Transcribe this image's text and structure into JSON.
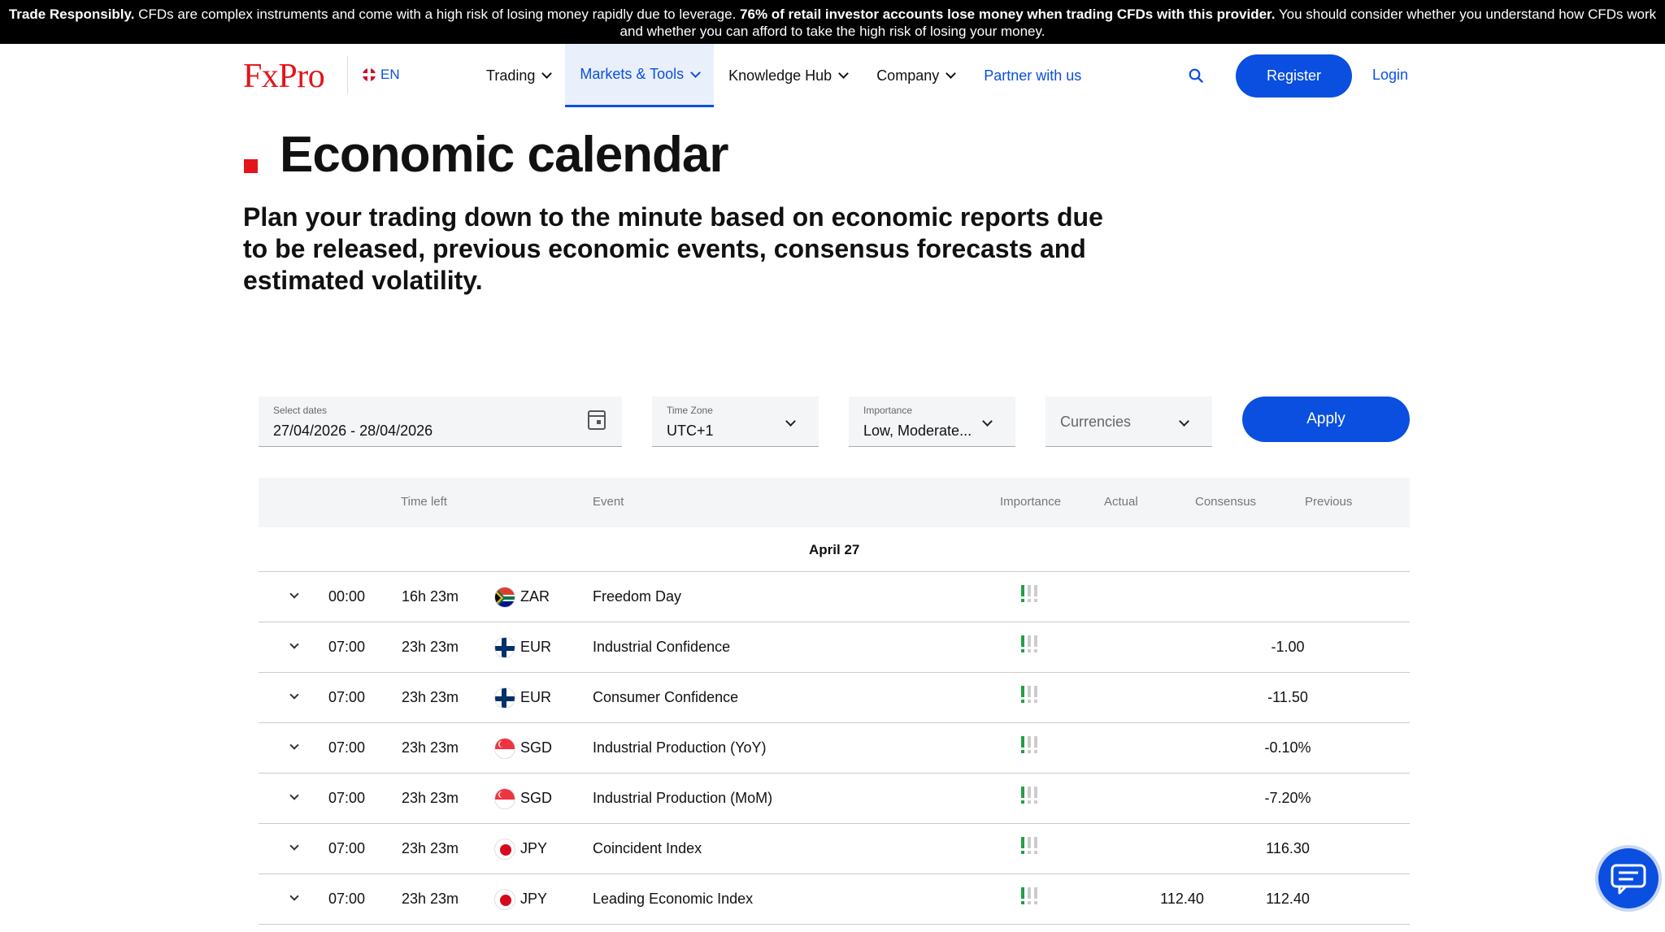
{
  "risk_warning": {
    "bold1": "Trade Responsibly.",
    "text1": " CFDs are complex instruments and come with a high risk of losing money rapidly due to leverage. ",
    "bold2": "76% of retail investor accounts lose money when trading CFDs with this provider.",
    "text2": " You should consider whether you understand how CFDs work and whether you can afford to take the high risk of losing your money."
  },
  "header": {
    "logo": "FxPro",
    "language": "EN",
    "menu": [
      {
        "label": "Trading",
        "dropdown": true
      },
      {
        "label": "Markets & Tools",
        "dropdown": true
      },
      {
        "label": "Knowledge Hub",
        "dropdown": true
      },
      {
        "label": "Company",
        "dropdown": true
      },
      {
        "label": "Partner with us",
        "dropdown": false
      }
    ],
    "register_label": "Register",
    "login_label": "Login"
  },
  "page": {
    "title": "Economic calendar",
    "subtitle": "Plan your trading down to the minute based on economic reports due to be released, previous economic events, consensus forecasts and estimated volatility."
  },
  "filters": {
    "dates_label": "Select dates",
    "dates_value": "27/04/2026 - 28/04/2026",
    "tz_label": "Time Zone",
    "tz_value": "UTC+1",
    "importance_label": "Importance",
    "importance_value": "Low, Moderate...",
    "currencies_placeholder": "Currencies",
    "apply_label": "Apply"
  },
  "table": {
    "headers": {
      "time_left": "Time left",
      "event": "Event",
      "importance": "Importance",
      "actual": "Actual",
      "consensus": "Consensus",
      "previous": "Previous"
    },
    "day_label": "April 27",
    "rows": [
      {
        "time": "00:00",
        "time_left": "16h 23m",
        "flag": "za",
        "currency": "ZAR",
        "event": "Freedom Day",
        "importance": 1,
        "actual": "",
        "consensus": "",
        "previous": ""
      },
      {
        "time": "07:00",
        "time_left": "23h 23m",
        "flag": "fi",
        "currency": "EUR",
        "event": "Industrial Confidence",
        "importance": 1,
        "actual": "",
        "consensus": "",
        "previous": "-1.00"
      },
      {
        "time": "07:00",
        "time_left": "23h 23m",
        "flag": "fi",
        "currency": "EUR",
        "event": "Consumer Confidence",
        "importance": 1,
        "actual": "",
        "consensus": "",
        "previous": "-11.50"
      },
      {
        "time": "07:00",
        "time_left": "23h 23m",
        "flag": "sg",
        "currency": "SGD",
        "event": "Industrial Production (YoY)",
        "importance": 1,
        "actual": "",
        "consensus": "",
        "previous": "-0.10%"
      },
      {
        "time": "07:00",
        "time_left": "23h 23m",
        "flag": "sg",
        "currency": "SGD",
        "event": "Industrial Production (MoM)",
        "importance": 1,
        "actual": "",
        "consensus": "",
        "previous": "-7.20%"
      },
      {
        "time": "07:00",
        "time_left": "23h 23m",
        "flag": "jp",
        "currency": "JPY",
        "event": "Coincident Index",
        "importance": 1,
        "actual": "",
        "consensus": "",
        "previous": "116.30"
      },
      {
        "time": "07:00",
        "time_left": "23h 23m",
        "flag": "jp",
        "currency": "JPY",
        "event": "Leading Economic Index",
        "importance": 1,
        "actual": "",
        "consensus": "112.40",
        "previous": "112.40"
      }
    ]
  },
  "colors": {
    "brand_red": "#e4141b",
    "accent_blue": "#0a4fe0",
    "importance_on": "#22a045",
    "importance_off": "#cccccc"
  }
}
